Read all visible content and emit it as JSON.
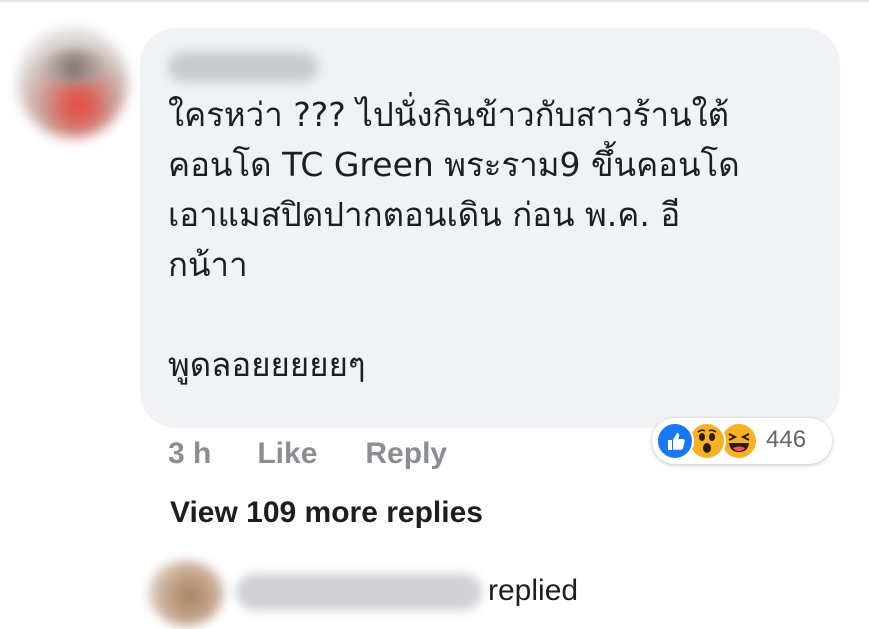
{
  "comment": {
    "text": "ใครหว่า ??? ไปนั่งกินข้าวกับสาวร้านใต้\nคอนโด TC Green พระราม9 ขึ้นคอนโด\nเอาแมสปิดปากตอนเดิน ก่อน พ.ค. อี\nกน้าา\n\nพูดลอยยยยยๆ",
    "time": "3 h",
    "like_label": "Like",
    "reply_label": "Reply",
    "reactions": {
      "icons": [
        "like-icon",
        "wow-icon",
        "haha-icon"
      ],
      "count": "446"
    }
  },
  "view_more": "View 109 more replies",
  "latest_reply": {
    "action": "replied"
  },
  "colors": {
    "bubble": "#f0f2f5",
    "like_blue": "#1877f2",
    "emoji_yellow": "#f7b125",
    "muted_text": "#8a8d91"
  }
}
